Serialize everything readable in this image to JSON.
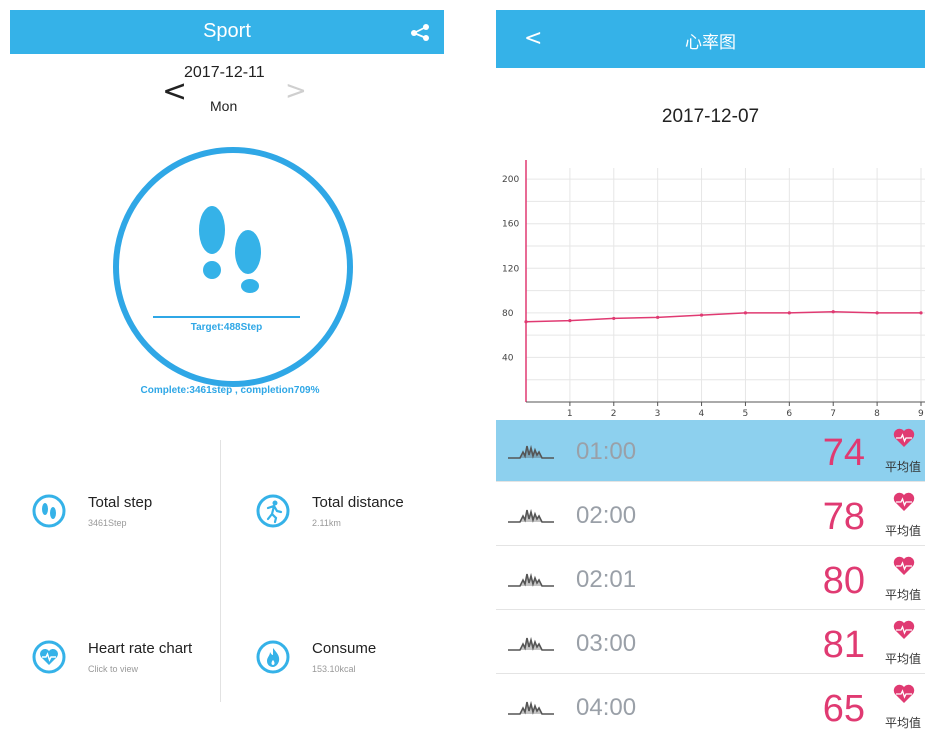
{
  "left": {
    "title": "Sport",
    "share_icon": "share-icon",
    "date": "2017-12-11",
    "weekday": "Mon",
    "prev_glyph": "<",
    "next_glyph": ">",
    "target": "Target:488Step",
    "complete": "Complete:3461step , completion709%",
    "stats": [
      {
        "label": "Total step",
        "value": "3461Step",
        "icon": "footprint-icon"
      },
      {
        "label": "Total distance",
        "value": "2.11km",
        "icon": "runner-icon"
      },
      {
        "label": "Heart rate chart",
        "value": "Click to view",
        "icon": "heart-icon"
      },
      {
        "label": "Consume",
        "value": "153.10kcal",
        "icon": "flame-icon"
      }
    ],
    "accent": "#35b2e8"
  },
  "right": {
    "back_glyph": "<",
    "title": "心率图",
    "date": "2017-12-07",
    "rows": [
      {
        "time": "01:00",
        "value": "74",
        "avg_label": "平均值",
        "active": true
      },
      {
        "time": "02:00",
        "value": "78",
        "avg_label": "平均值",
        "active": false
      },
      {
        "time": "02:01",
        "value": "80",
        "avg_label": "平均值",
        "active": false
      },
      {
        "time": "03:00",
        "value": "81",
        "avg_label": "平均值",
        "active": false
      },
      {
        "time": "04:00",
        "value": "65",
        "avg_label": "平均值",
        "active": false
      }
    ],
    "value_color": "#e03a72"
  },
  "chart_data": {
    "type": "line",
    "title": "",
    "xlabel": "",
    "ylabel": "",
    "x": [
      0,
      1,
      2,
      3,
      4,
      5,
      6,
      7,
      8,
      9
    ],
    "x_ticks": [
      "1",
      "2",
      "3",
      "4",
      "5",
      "6",
      "7",
      "8",
      "9"
    ],
    "y_ticks": [
      "40",
      "80",
      "120",
      "160",
      "200"
    ],
    "series": [
      {
        "values": [
          72,
          73,
          75,
          76,
          78,
          80,
          80,
          81,
          80,
          80
        ]
      }
    ],
    "xlim": [
      0,
      9
    ],
    "ylim": [
      0,
      210
    ],
    "grid": true,
    "color": "#e03a72"
  }
}
